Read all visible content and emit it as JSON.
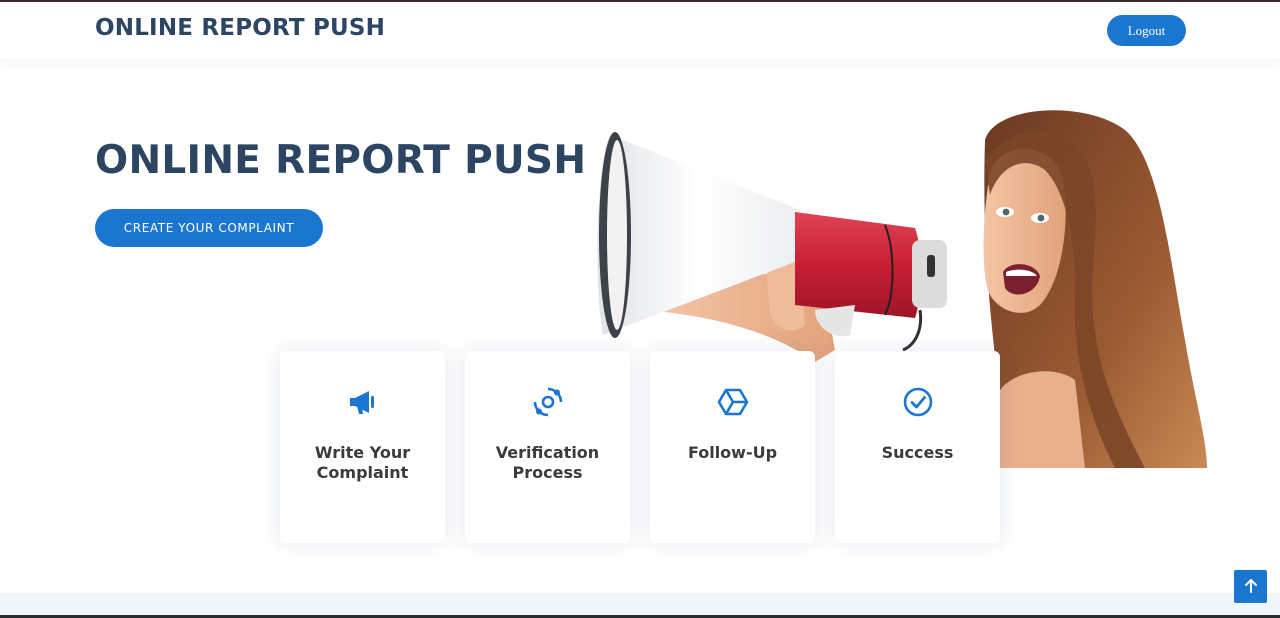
{
  "header": {
    "logo": "ONLINE REPORT PUSH",
    "logout_label": "Logout"
  },
  "hero": {
    "title": "ONLINE REPORT PUSH",
    "cta_label": "CREATE YOUR COMPLAINT",
    "image": "woman-with-megaphone-photo"
  },
  "cards": [
    {
      "icon": "megaphone-icon",
      "label": "Write Your Complaint"
    },
    {
      "icon": "orbit-icon",
      "label": "Verification Process"
    },
    {
      "icon": "hexagon-icon",
      "label": "Follow-Up"
    },
    {
      "icon": "check-circle-icon",
      "label": "Success"
    }
  ],
  "scroll_top_icon": "arrow-up-icon",
  "colors": {
    "accent": "#1b76cf",
    "heading": "#2b4563",
    "card_text": "#3b3b3b",
    "footer_band": "#f1f6fb"
  }
}
